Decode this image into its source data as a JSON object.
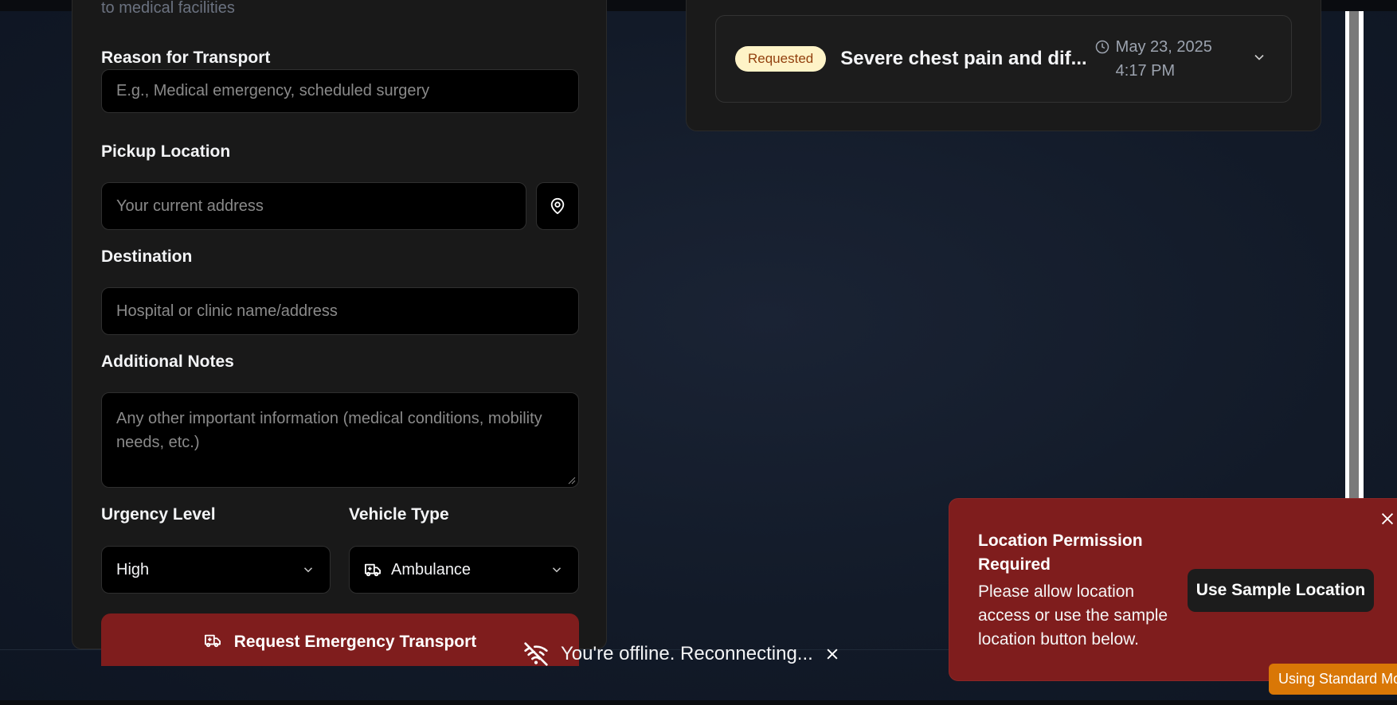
{
  "form": {
    "subtitle": "to medical facilities",
    "reason": {
      "label": "Reason for Transport",
      "placeholder": "E.g., Medical emergency, scheduled surgery"
    },
    "pickup": {
      "label": "Pickup Location",
      "placeholder": "Your current address"
    },
    "destination": {
      "label": "Destination",
      "placeholder": "Hospital or clinic name/address"
    },
    "notes": {
      "label": "Additional Notes",
      "placeholder": "Any other important information (medical conditions, mobility needs, etc.)"
    },
    "urgency": {
      "label": "Urgency Level",
      "value": "High"
    },
    "vehicle": {
      "label": "Vehicle Type",
      "value": "Ambulance"
    },
    "submit_label": "Request Emergency Transport"
  },
  "requests": [
    {
      "status": "Requested",
      "title": "Severe chest pain and dif...",
      "time": "May 23, 2025 4:17 PM"
    }
  ],
  "toast": {
    "title": "Location Permission Required",
    "body": "Please allow location access or use the sample location button below.",
    "action": "Use Sample Location"
  },
  "offline_text": "You're offline. Reconnecting...",
  "mode_badge": "Using Standard Mo",
  "colors": {
    "danger": "#7f1d1d",
    "badge_bg": "#fef3c7",
    "warning": "#d97706"
  }
}
